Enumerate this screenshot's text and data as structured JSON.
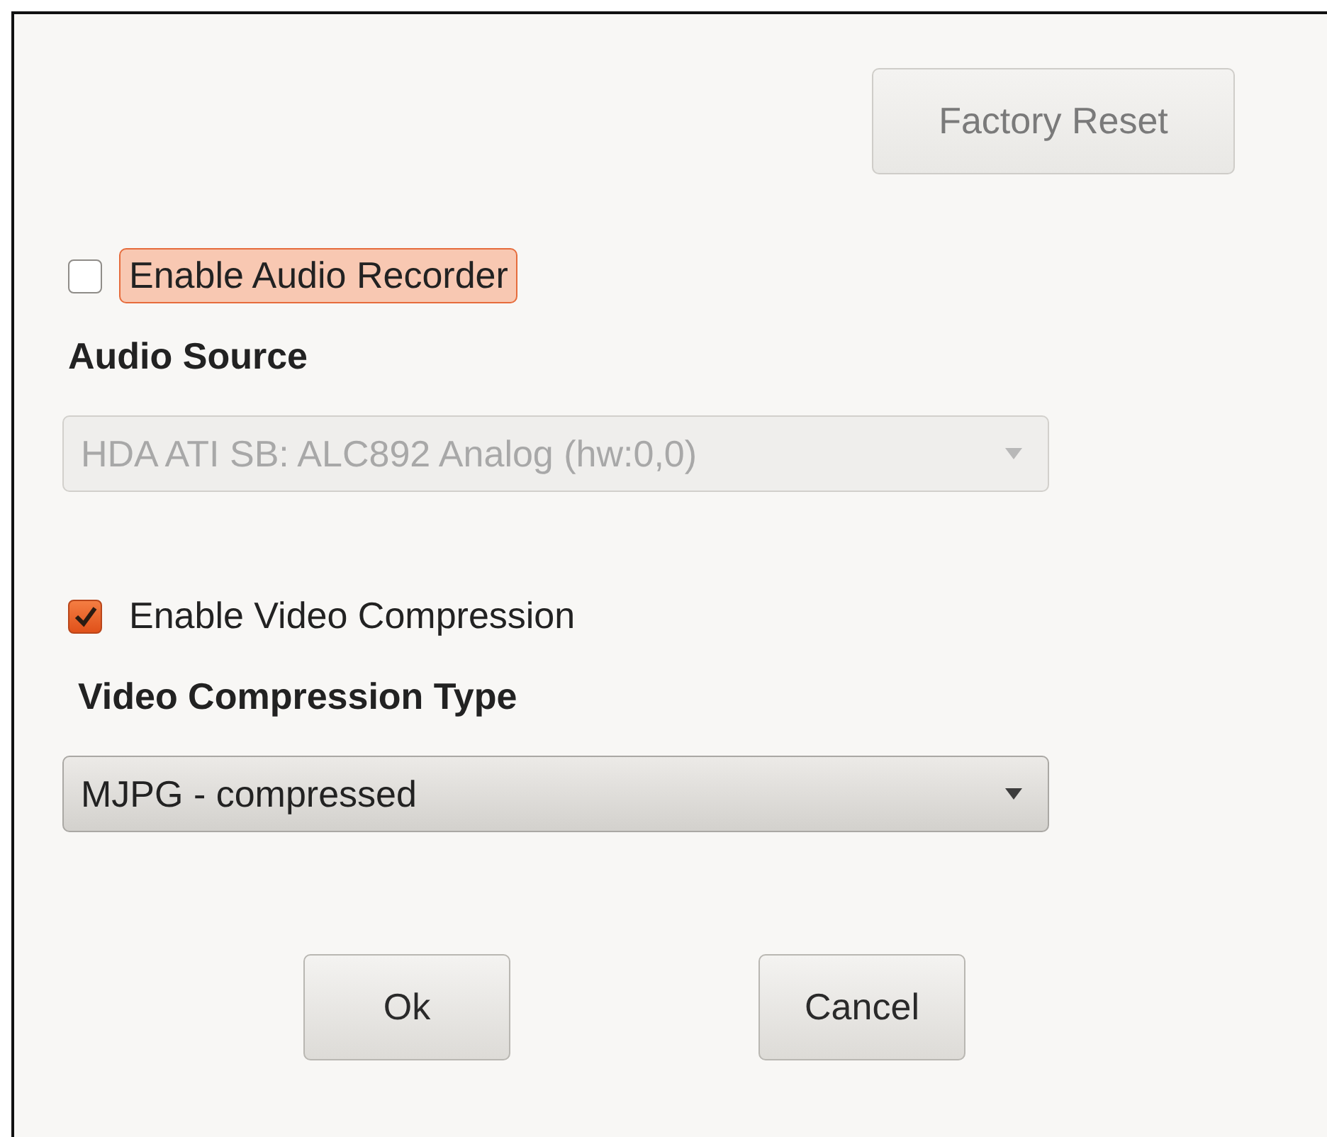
{
  "factory_reset": {
    "label": "Factory Reset",
    "disabled": true
  },
  "audio_recorder": {
    "label": "Enable Audio Recorder",
    "checked": false,
    "focused": true
  },
  "audio_source": {
    "label": "Audio Source",
    "value": "HDA ATI SB: ALC892 Analog (hw:0,0)",
    "disabled": true
  },
  "video_compression": {
    "label": "Enable Video Compression",
    "checked": true,
    "focused": false
  },
  "compression_type": {
    "label": "Video Compression Type",
    "value": "MJPG - compressed",
    "disabled": false
  },
  "buttons": [
    {
      "label": "Ok"
    },
    {
      "label": "Cancel"
    }
  ]
}
